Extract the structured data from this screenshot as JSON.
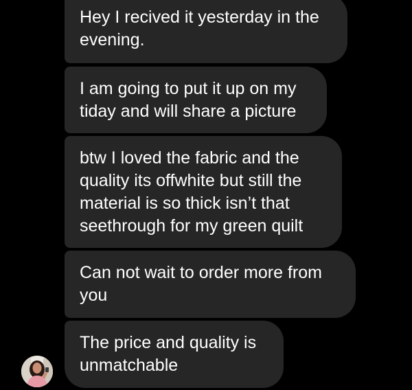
{
  "conversation": {
    "messages": [
      {
        "text": "Hey I recived it yesterday in the\nevening."
      },
      {
        "text": "I am going to put it up on my\ntiday and will share a picture"
      },
      {
        "text": "btw I loved the fabric and the\nquality its offwhite but still the\nmaterial is so thick isn’t that\nseethrough for my green quilt"
      },
      {
        "text": "Can not wait to order more from\nyou"
      },
      {
        "text": "The price and quality is\nunmatchable"
      }
    ],
    "colors": {
      "background": "#000000",
      "bubble": "#262626",
      "text": "#ffffff"
    }
  },
  "sender": {
    "avatar_icon": "profile-photo-avatar"
  }
}
